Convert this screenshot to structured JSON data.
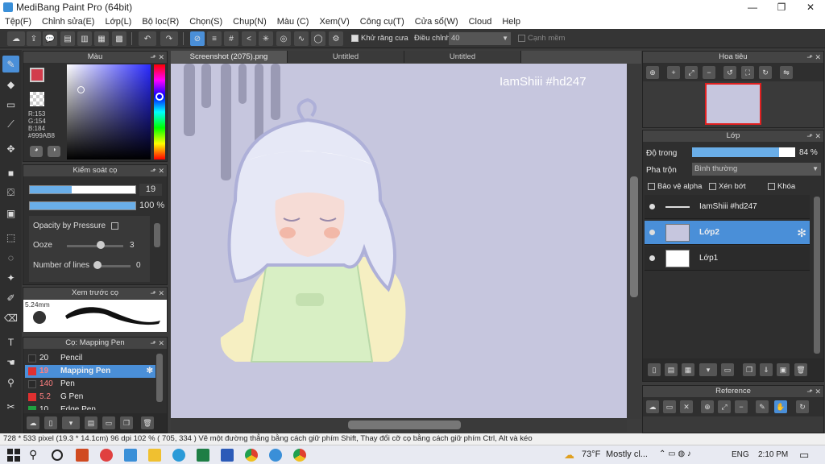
{
  "app": {
    "title": "MediBang Paint Pro (64bit)",
    "minimize": "—",
    "restore": "❐",
    "close": "✕"
  },
  "menu": [
    "Tệp(F)",
    "Chỉnh sửa(E)",
    "Lớp(L)",
    "Bộ lọc(R)",
    "Chọn(S)",
    "Chụp(N)",
    "Màu (C)",
    "Xem(V)",
    "Công cụ(T)",
    "Cửa sổ(W)",
    "Cloud",
    "Help"
  ],
  "toolbar": {
    "antialias_label": "Khử răng cưa",
    "adjust_label": "Điều chỉnh",
    "adjust_value": "40",
    "smooth_label": "Cạnh mềm"
  },
  "color_panel": {
    "title": "Màu",
    "r": "R:153",
    "g": "G:154",
    "b": "B:184",
    "hex": "#999AB8",
    "primary": "#d23c4c",
    "secondary": "#999ab8"
  },
  "brush_control": {
    "title": "Kiểm soát cọ",
    "size_value": "19",
    "opacity_value": "100 %",
    "opacity_pressure_label": "Opacity by Pressure",
    "ooze_label": "Ooze",
    "ooze_value": "3",
    "lines_label": "Number of lines",
    "lines_value": "0",
    "size_fraction": 0.4,
    "opacity_fraction": 1.0
  },
  "brush_preview": {
    "title": "Xem trước cọ",
    "size_label": "5.24mm"
  },
  "brush_list": {
    "title": "Cọ: Mapping Pen",
    "items": [
      {
        "size": "20",
        "name": "Pencil",
        "color": "#2a2a2a",
        "selected": false
      },
      {
        "size": "19",
        "name": "Mapping Pen",
        "color": "#e03030",
        "selected": true
      },
      {
        "size": "140",
        "name": "Pen",
        "color": "#2a2a2a",
        "selected": false
      },
      {
        "size": "5.2",
        "name": "G Pen",
        "color": "#e03030",
        "selected": false
      },
      {
        "size": "10",
        "name": "Edge Pen",
        "color": "#20a040",
        "selected": false
      }
    ]
  },
  "tabs": [
    "Screenshot (2075).png",
    "Untitled",
    "Untitled"
  ],
  "canvas": {
    "watermark": "IamShiii #hd247"
  },
  "navigator": {
    "title": "Hoa tiêu"
  },
  "layers": {
    "title": "Lớp",
    "opacity_label": "Độ trong",
    "opacity_value": "84 %",
    "opacity_fraction": 0.84,
    "blend_label": "Pha trộn",
    "blend_value": "Bình thường",
    "protect_alpha": "Bảo vệ alpha",
    "clip": "Xén bớt",
    "lock": "Khóa",
    "items": [
      {
        "name": "IamShiii #hd247",
        "selected": false
      },
      {
        "name": "Lớp2",
        "selected": true
      },
      {
        "name": "Lớp1",
        "selected": false
      }
    ]
  },
  "reference": {
    "title": "Reference"
  },
  "status": {
    "text": "728 * 533 pixel  (19.3 * 14.1cm)  96 dpi  102 %  ( 705, 334 )  Vẽ một đường thẳng bằng cách giữ phím Shift, Thay đổi cỡ cọ bằng cách giữ phím Ctrl, Alt và kéo"
  },
  "taskbar": {
    "weather_temp": "73°F",
    "weather_text": "Mostly cl...",
    "lang": "ENG",
    "time": "2:10 PM"
  }
}
